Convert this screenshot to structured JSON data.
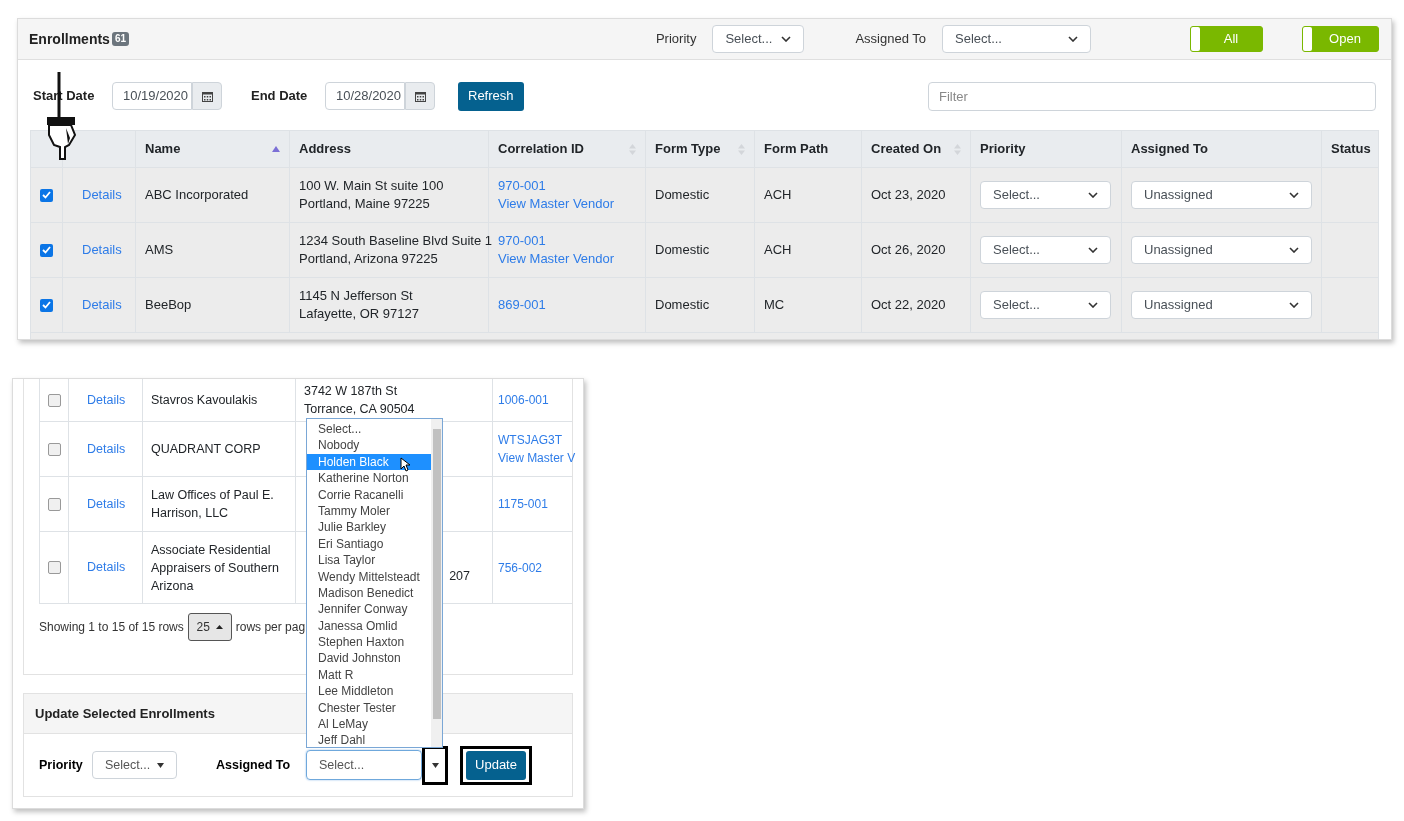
{
  "enrollments": {
    "title": "Enrollments",
    "count": "61",
    "filters": [
      {
        "label": "Priority",
        "value": "Select..."
      },
      {
        "label": "Assigned To",
        "value": "Select..."
      }
    ],
    "toggles": [
      {
        "label": "All",
        "on": true
      },
      {
        "label": "Open",
        "on": true
      }
    ],
    "dates": [
      {
        "label": "Start Date",
        "value": "10/19/2020"
      },
      {
        "label": "End Date",
        "value": "10/28/2020"
      }
    ],
    "refresh": "Refresh",
    "filter": {
      "placeholder": "Filter"
    },
    "columns": [
      {
        "label": "Name",
        "sortable": true,
        "sorted": true
      },
      {
        "label": "Address",
        "sortable": false,
        "sorted": false
      },
      {
        "label": "Correlation ID",
        "sortable": true,
        "sorted": false
      },
      {
        "label": "Form Type",
        "sortable": true,
        "sorted": false
      },
      {
        "label": "Form Path",
        "sortable": false,
        "sorted": false
      },
      {
        "label": "Created On",
        "sortable": true,
        "sorted": false
      },
      {
        "label": "Priority",
        "sortable": false,
        "sorted": false
      },
      {
        "label": "Assigned To",
        "sortable": false,
        "sorted": false
      },
      {
        "label": "Status",
        "sortable": false,
        "sorted": false
      }
    ],
    "rows": [
      {
        "checked": true,
        "link": "Details",
        "name": "ABC Incorporated",
        "address": [
          "100 W. Main St suite 100",
          "Portland, Maine 97225"
        ],
        "ids": [
          "970-001",
          "View Master Vendor"
        ],
        "form_type": "Domestic",
        "form_path": "ACH",
        "created": "Oct 23, 2020",
        "priority": "Select...",
        "assigned": "Unassigned"
      },
      {
        "checked": true,
        "link": "Details",
        "name": "AMS",
        "address": [
          "1234 South Baseline Blvd Suite 1",
          "Portland, Arizona 97225"
        ],
        "ids": [
          "970-001",
          "View Master Vendor"
        ],
        "form_type": "Domestic",
        "form_path": "ACH",
        "created": "Oct 26, 2020",
        "priority": "Select...",
        "assigned": "Unassigned"
      },
      {
        "checked": true,
        "link": "Details",
        "name": "BeeBop",
        "address": [
          "1145 N Jefferson St",
          "Lafayette, OR 97127"
        ],
        "ids": [
          "869-001"
        ],
        "form_type": "Domestic",
        "form_path": "MC",
        "created": "Oct 22, 2020",
        "priority": "Select...",
        "assigned": "Unassigned"
      }
    ]
  },
  "update_view": {
    "rows": [
      {
        "checked": false,
        "link": "Details",
        "name": "Stavros Kavoulakis",
        "address": [
          "3742 W 187th St",
          "Torrance, CA 90504"
        ],
        "ids": [
          "1006-001"
        ]
      },
      {
        "checked": false,
        "link": "Details",
        "name": "QUADRANT CORP",
        "ids": [
          "WTSJAG3T",
          "View Master V"
        ]
      },
      {
        "checked": false,
        "link": "Details",
        "name": "Law Offices of Paul E. Harrison, LLC",
        "ids": [
          "1175-001"
        ]
      },
      {
        "checked": false,
        "link": "Details",
        "name": "Associate Residential Appraisers of Southern Arizona",
        "address_tail": "207",
        "ids": [
          "756-002"
        ]
      }
    ],
    "footer": {
      "text": "Showing 1 to 15 of 15 rows",
      "page_size": "25",
      "suffix": "rows per pag"
    },
    "card": {
      "title": "Update Selected Enrollments",
      "priority": {
        "label": "Priority",
        "value": "Select..."
      },
      "assigned": {
        "label": "Assigned To",
        "value": "Select..."
      },
      "button": "Update"
    },
    "options": [
      {
        "label": "Select...",
        "selected": false
      },
      {
        "label": "Nobody",
        "selected": false
      },
      {
        "label": "Holden Black",
        "selected": true
      },
      {
        "label": "Katherine Norton",
        "selected": false
      },
      {
        "label": "Corrie Racanelli",
        "selected": false
      },
      {
        "label": "Tammy Moler",
        "selected": false
      },
      {
        "label": "Julie Barkley",
        "selected": false
      },
      {
        "label": "Eri Santiago",
        "selected": false
      },
      {
        "label": "Lisa Taylor",
        "selected": false
      },
      {
        "label": "Wendy Mittelsteadt",
        "selected": false
      },
      {
        "label": "Madison Benedict",
        "selected": false
      },
      {
        "label": "Jennifer Conway",
        "selected": false
      },
      {
        "label": "Janessa Omlid",
        "selected": false
      },
      {
        "label": "Stephen Haxton",
        "selected": false
      },
      {
        "label": "David Johnston",
        "selected": false
      },
      {
        "label": "Matt R",
        "selected": false
      },
      {
        "label": "Lee Middleton",
        "selected": false
      },
      {
        "label": "Chester Tester",
        "selected": false
      },
      {
        "label": "Al LeMay",
        "selected": false
      },
      {
        "label": "Jeff Dahl",
        "selected": false
      }
    ]
  }
}
